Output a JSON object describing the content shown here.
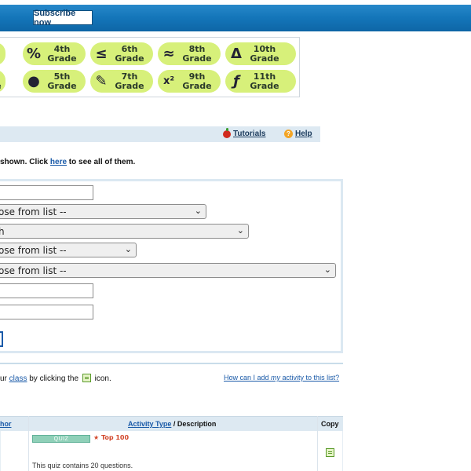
{
  "header": {
    "subscribe_label": "Subscribe now"
  },
  "grades": {
    "row1": [
      {
        "line1": "",
        "line2": "e",
        "icon": "partial-icon",
        "glyph": ""
      },
      {
        "line1": "4th",
        "line2": "Grade",
        "icon": "percent-icon",
        "glyph": "%"
      },
      {
        "line1": "6th",
        "line2": "Grade",
        "icon": "less-equal-icon",
        "glyph": "≤"
      },
      {
        "line1": "8th",
        "line2": "Grade",
        "icon": "approx-icon",
        "glyph": "≈"
      },
      {
        "line1": "10th",
        "line2": "Grade",
        "icon": "triangle-icon",
        "glyph": "Δ"
      }
    ],
    "row2": [
      {
        "line1": "",
        "line2": "de",
        "icon": "partial-icon",
        "glyph": ""
      },
      {
        "line1": "5th",
        "line2": "Grade",
        "icon": "apple-book-icon",
        "glyph": "●"
      },
      {
        "line1": "7th",
        "line2": "Grade",
        "icon": "pencil-paper-icon",
        "glyph": "✎"
      },
      {
        "line1": "9th",
        "line2": "Grade",
        "icon": "x-squared-icon",
        "glyph": "x²"
      },
      {
        "line1": "11th",
        "line2": "Grade",
        "icon": "function-icon",
        "glyph": "ƒ"
      }
    ]
  },
  "toolbar": {
    "tutorials_label": "Tutorials",
    "help_label": "Help"
  },
  "info": {
    "before": "shown. Click ",
    "link": "here",
    "after": " to see all of them."
  },
  "form": {
    "text1_value": "",
    "select1_value": "ose from list --",
    "select2_value": "h",
    "select3_value": "ose from list --",
    "select4_value": "ose from list --",
    "text2_value": "",
    "text3_value": ""
  },
  "class_line": {
    "before": "ur ",
    "link": "class",
    "middle": " by clicking the ",
    "after": " icon."
  },
  "howto": {
    "before": "How can I add ",
    "em": "my",
    "after": " activity to this list?"
  },
  "table": {
    "author_header": "hor",
    "activity_type_link": "Activity Type",
    "description_header": " / Description",
    "copy_header": "Copy",
    "row": {
      "type_badge": "QUIZ",
      "top_badge": "★ Top 100",
      "description": "This quiz contains 20 questions."
    }
  }
}
